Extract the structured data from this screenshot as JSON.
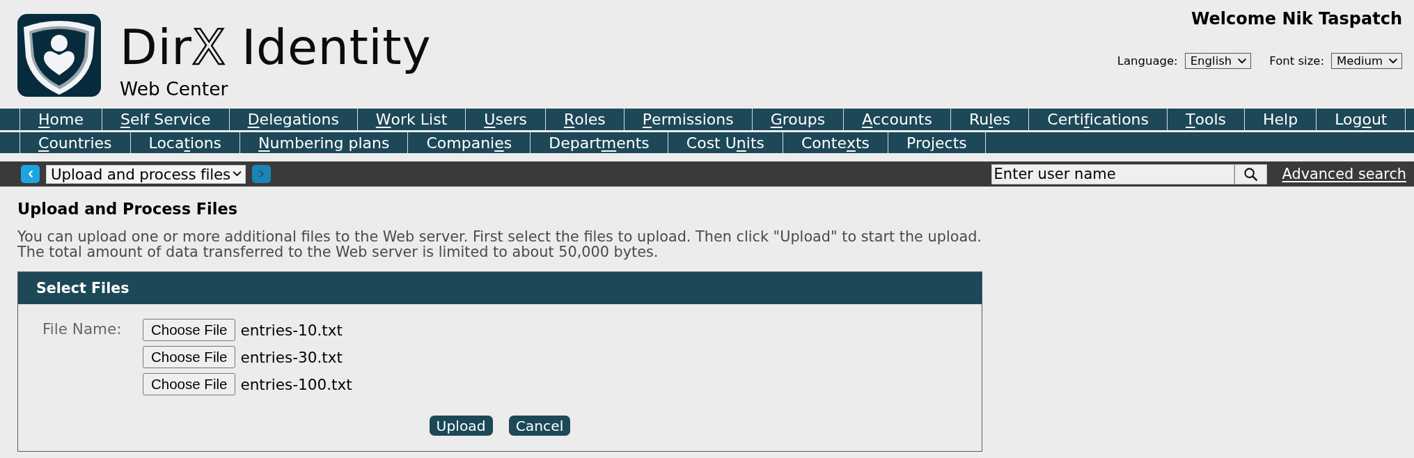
{
  "header": {
    "logo": {
      "wordmark_start": "Dir",
      "wordmark_mark": "X",
      "wordmark_end": "Identity",
      "subtitle": "Web Center"
    },
    "welcome": "Welcome Nik Taspatch",
    "language": {
      "label": "Language:",
      "value": "English"
    },
    "font_size": {
      "label": "Font size:",
      "value": "Medium"
    }
  },
  "nav_rows": [
    {
      "items": [
        {
          "parts": [
            {
              "text": "H",
              "underlined": true
            },
            {
              "text": "ome",
              "underlined": false
            }
          ]
        },
        {
          "parts": [
            {
              "text": "S",
              "underlined": true
            },
            {
              "text": "elf Service",
              "underlined": false
            }
          ]
        },
        {
          "parts": [
            {
              "text": "D",
              "underlined": true
            },
            {
              "text": "elegations",
              "underlined": false
            }
          ]
        },
        {
          "parts": [
            {
              "text": "W",
              "underlined": true
            },
            {
              "text": "ork List",
              "underlined": false
            }
          ]
        },
        {
          "parts": [
            {
              "text": "U",
              "underlined": true
            },
            {
              "text": "sers",
              "underlined": false
            }
          ]
        },
        {
          "parts": [
            {
              "text": "R",
              "underlined": true
            },
            {
              "text": "oles",
              "underlined": false
            }
          ]
        },
        {
          "parts": [
            {
              "text": "P",
              "underlined": true
            },
            {
              "text": "ermissions",
              "underlined": false
            }
          ]
        },
        {
          "parts": [
            {
              "text": "G",
              "underlined": true
            },
            {
              "text": "roups",
              "underlined": false
            }
          ]
        },
        {
          "parts": [
            {
              "text": "A",
              "underlined": true
            },
            {
              "text": "ccounts",
              "underlined": false
            }
          ]
        },
        {
          "parts": [
            {
              "text": "Ru",
              "underlined": false
            },
            {
              "text": "l",
              "underlined": true
            },
            {
              "text": "es",
              "underlined": false
            }
          ]
        },
        {
          "parts": [
            {
              "text": "Certi",
              "underlined": false
            },
            {
              "text": "f",
              "underlined": true
            },
            {
              "text": "ications",
              "underlined": false
            }
          ]
        },
        {
          "parts": [
            {
              "text": "T",
              "underlined": true
            },
            {
              "text": "ools",
              "underlined": false
            }
          ]
        },
        {
          "parts": [
            {
              "text": "Help",
              "underlined": false
            }
          ]
        },
        {
          "parts": [
            {
              "text": "Log",
              "underlined": false
            },
            {
              "text": "o",
              "underlined": true
            },
            {
              "text": "ut",
              "underlined": false
            }
          ]
        }
      ]
    },
    {
      "items": [
        {
          "parts": [
            {
              "text": "C",
              "underlined": true
            },
            {
              "text": "ountries",
              "underlined": false
            }
          ]
        },
        {
          "parts": [
            {
              "text": "Loca",
              "underlined": false
            },
            {
              "text": "t",
              "underlined": true
            },
            {
              "text": "ions",
              "underlined": false
            }
          ]
        },
        {
          "parts": [
            {
              "text": "N",
              "underlined": true
            },
            {
              "text": "umbering plans",
              "underlined": false
            }
          ]
        },
        {
          "parts": [
            {
              "text": "Compani",
              "underlined": false
            },
            {
              "text": "e",
              "underlined": true
            },
            {
              "text": "s",
              "underlined": false
            }
          ]
        },
        {
          "parts": [
            {
              "text": "Depart",
              "underlined": false
            },
            {
              "text": "m",
              "underlined": true
            },
            {
              "text": "ents",
              "underlined": false
            }
          ]
        },
        {
          "parts": [
            {
              "text": "Cost U",
              "underlined": false
            },
            {
              "text": "n",
              "underlined": true
            },
            {
              "text": "its",
              "underlined": false
            }
          ]
        },
        {
          "parts": [
            {
              "text": "Conte",
              "underlined": false
            },
            {
              "text": "x",
              "underlined": true
            },
            {
              "text": "ts",
              "underlined": false
            }
          ]
        },
        {
          "parts": [
            {
              "text": "Projects",
              "underlined": false
            }
          ]
        }
      ]
    }
  ],
  "toolbar": {
    "previous": {
      "disabled": false
    },
    "page_select": "Upload and process files",
    "next": {
      "disabled": true
    },
    "search": {
      "placeholder": "Enter user name"
    },
    "advanced_search": "Advanced search"
  },
  "page": {
    "title": "Upload and Process Files",
    "description": [
      "You can upload one or more additional files to the Web server. First select the files to upload. Then click \"Upload\" to start the upload.",
      "The total amount of data transferred to the Web server is limited to about 50,000 bytes."
    ]
  },
  "panel": {
    "title": "Select Files",
    "field_label": "File Name:",
    "files": [
      {
        "button": "Choose File",
        "name": "entries-10.txt"
      },
      {
        "button": "Choose File",
        "name": "entries-30.txt"
      },
      {
        "button": "Choose File",
        "name": "entries-100.txt"
      }
    ],
    "buttons": [
      "Upload",
      "Cancel"
    ]
  }
}
